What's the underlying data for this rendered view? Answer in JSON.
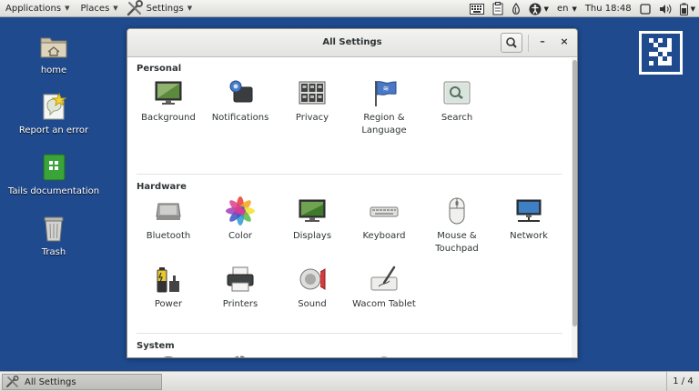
{
  "top_panel": {
    "applications_label": "Applications",
    "places_label": "Places",
    "settings_label": "Settings",
    "language": "en",
    "clock": "Thu 18:48"
  },
  "desktop": {
    "icons": [
      {
        "label": "home",
        "icon": "folder-home-icon"
      },
      {
        "label": "Report an error",
        "icon": "report-error-icon"
      },
      {
        "label": "Tails documentation",
        "icon": "documentation-icon"
      },
      {
        "label": "Trash",
        "icon": "trash-icon"
      }
    ]
  },
  "window": {
    "title": "All Settings",
    "sections": [
      {
        "title": "Personal",
        "items": [
          {
            "label": "Background",
            "icon": "background-icon"
          },
          {
            "label": "Notifications",
            "icon": "notifications-icon"
          },
          {
            "label": "Privacy",
            "icon": "privacy-icon"
          },
          {
            "label": "Region & Language",
            "icon": "region-language-icon"
          },
          {
            "label": "Search",
            "icon": "search-settings-icon"
          }
        ]
      },
      {
        "title": "Hardware",
        "items": [
          {
            "label": "Bluetooth",
            "icon": "bluetooth-icon"
          },
          {
            "label": "Color",
            "icon": "color-icon"
          },
          {
            "label": "Displays",
            "icon": "displays-icon"
          },
          {
            "label": "Keyboard",
            "icon": "keyboard-icon"
          },
          {
            "label": "Mouse & Touchpad",
            "icon": "mouse-touchpad-icon"
          },
          {
            "label": "Network",
            "icon": "network-icon"
          },
          {
            "label": "Power",
            "icon": "power-icon"
          },
          {
            "label": "Printers",
            "icon": "printers-icon"
          },
          {
            "label": "Sound",
            "icon": "sound-icon"
          },
          {
            "label": "Wacom Tablet",
            "icon": "wacom-tablet-icon"
          }
        ]
      },
      {
        "title": "System",
        "items": [
          {
            "label": "",
            "icon": "date-time-icon"
          },
          {
            "label": "",
            "icon": "details-icon"
          },
          {
            "label": "",
            "icon": "sharing-icon"
          },
          {
            "label": "",
            "icon": "universal-access-icon"
          },
          {
            "label": "",
            "icon": "users-icon"
          }
        ]
      }
    ]
  },
  "bottom_panel": {
    "task_label": "All Settings",
    "workspace": "1 / 4"
  },
  "colors": {
    "desktop_background": "#1f4a8e",
    "panel_background": "#e5e5e2",
    "window_background": "#ffffff"
  }
}
